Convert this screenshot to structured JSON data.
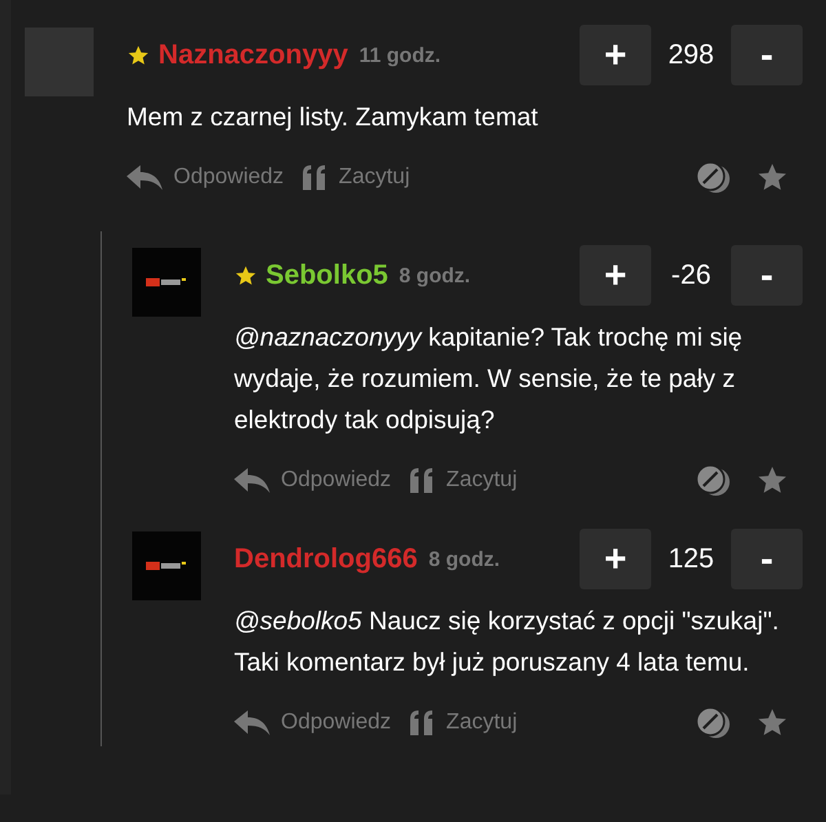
{
  "thread": {
    "comment": {
      "author": "Naznaczonyyy",
      "color": "#d42a2a",
      "starred": true,
      "kind": "plain",
      "time": "11 godz.",
      "vote_up": "+",
      "score": "298",
      "vote_down": "-",
      "body": "Mem z czarnej listy. Zamykam temat",
      "reply_label": "Odpowiedz",
      "quote_label": "Zacytuj"
    },
    "children": [
      {
        "author": "Sebolko5",
        "color": "#7ac832",
        "starred": true,
        "kind": "logo",
        "time": "8 godz.",
        "vote_up": "+",
        "score": "-26",
        "vote_down": "-",
        "body": "*@naznaczonyyy* kapitanie? Tak trochę mi się wydaje, że rozumiem. W sensie, że te pały z elektrody tak odpisują?",
        "reply_label": "Odpowiedz",
        "quote_label": "Zacytuj"
      },
      {
        "author": "Dendrolog666",
        "color": "#d42a2a",
        "starred": false,
        "kind": "logo",
        "time": "8 godz.",
        "vote_up": "+",
        "score": "125",
        "vote_down": "-",
        "body": "*@sebolko5* Naucz się korzystać z opcji \"szukaj\". Taki komentarz był już poruszany 4 lata temu.",
        "reply_label": "Odpowiedz",
        "quote_label": "Zacytuj"
      }
    ]
  }
}
